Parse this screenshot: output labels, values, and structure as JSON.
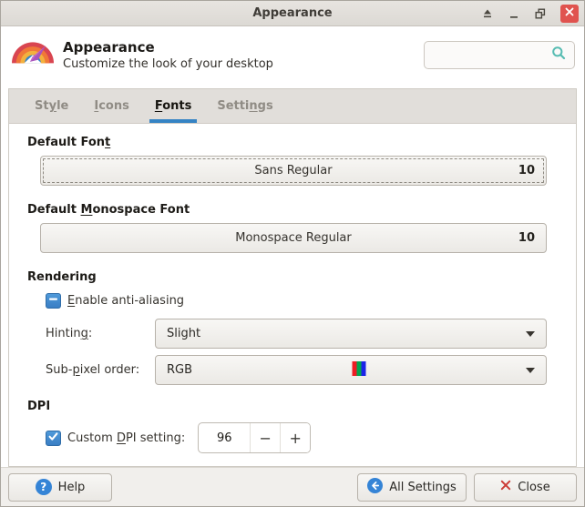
{
  "titlebar": {
    "title": "Appearance"
  },
  "header": {
    "title": "Appearance",
    "subtitle": "Customize the look of your desktop",
    "search_value": ""
  },
  "tabs": [
    {
      "pre": "St",
      "mn": "y",
      "post": "le",
      "active": false
    },
    {
      "pre": "",
      "mn": "I",
      "post": "cons",
      "active": false
    },
    {
      "pre": "",
      "mn": "F",
      "post": "onts",
      "active": true
    },
    {
      "pre": "Setti",
      "mn": "n",
      "post": "gs",
      "active": false
    }
  ],
  "sections": {
    "default_font": {
      "heading_pre": "Default Fon",
      "heading_mn": "t",
      "heading_post": "",
      "button_label": "Sans Regular",
      "button_size": "10"
    },
    "default_mono": {
      "heading_pre": "Default ",
      "heading_mn": "M",
      "heading_post": "onospace Font",
      "button_label": "Monospace Regular",
      "button_size": "10"
    },
    "rendering": {
      "heading": "Rendering",
      "antialias": {
        "pre": "",
        "mn": "E",
        "post": "nable anti-aliasing",
        "state": "indeterminate"
      },
      "hinting": {
        "label_pre": "Hintin",
        "label_mn": "g",
        "label_post": ":",
        "value": "Slight"
      },
      "subpixel": {
        "label_pre": "Sub-",
        "label_mn": "p",
        "label_post": "ixel order:",
        "value": "RGB"
      }
    },
    "dpi": {
      "heading": "DPI",
      "custom": {
        "pre": "Custom ",
        "mn": "D",
        "post": "PI setting:",
        "state": "checked"
      },
      "spin": {
        "value": "96",
        "minus": "−",
        "plus": "+"
      }
    }
  },
  "footer": {
    "help_label": "Help",
    "all_settings_label": "All Settings",
    "close_label": "Close"
  },
  "colors": {
    "accent_blue": "#3583c4",
    "checkbox_blue": "#3a7ec4",
    "titlebar_close_red": "#e0534f",
    "close_x_red": "#cc3b36",
    "search_teal": "#57bcb2",
    "rgb_stripes": [
      "#ed1c24",
      "#00a651",
      "#1b24e8"
    ]
  }
}
